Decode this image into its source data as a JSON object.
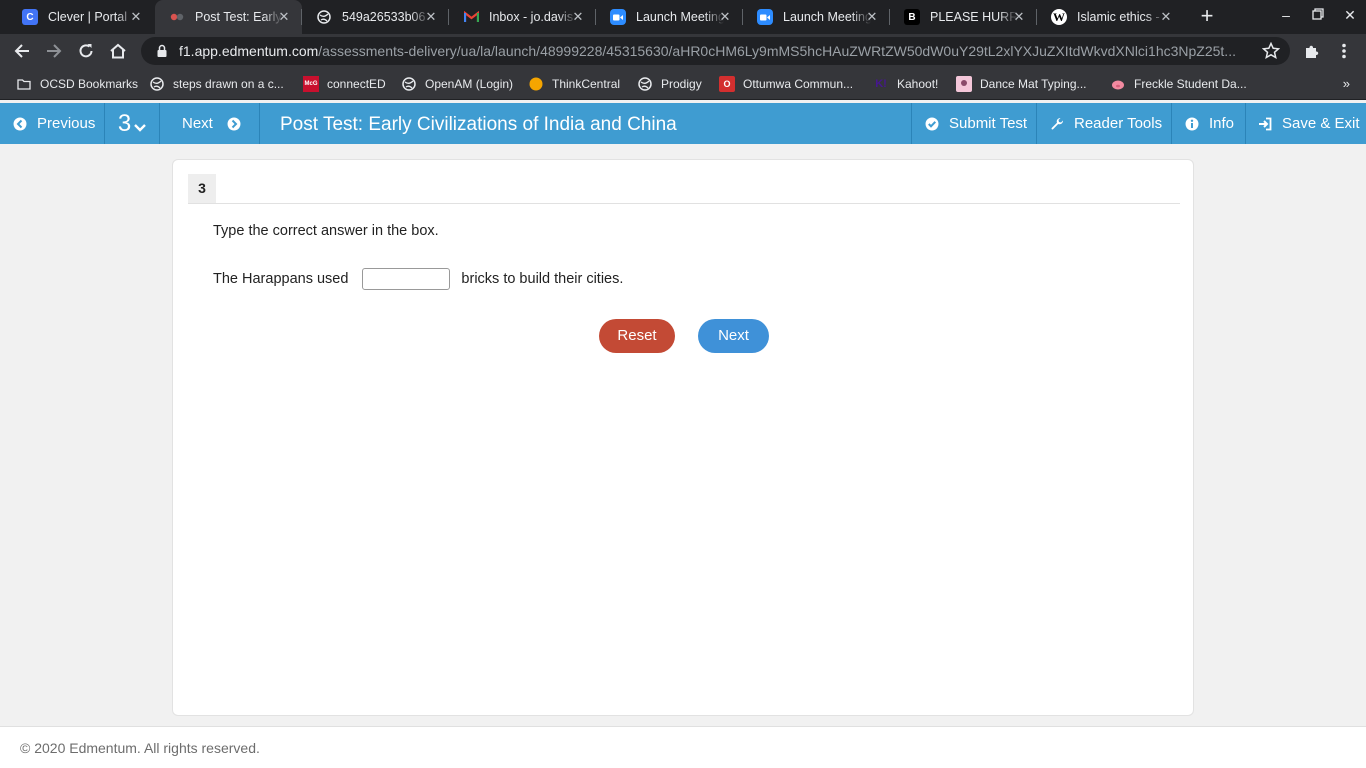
{
  "browser": {
    "tabs": [
      {
        "label": "Clever | Portal",
        "icon": "C",
        "icon_bg": "#4274f6"
      },
      {
        "label": "Post Test: Early",
        "icon": "edm",
        "icon_bg": "#35363a",
        "active": true
      },
      {
        "label": "549a26533b06",
        "icon": "globe",
        "icon_bg": "#35363a"
      },
      {
        "label": "Inbox - jo.davis",
        "icon": "M",
        "icon_bg": "#35363a"
      },
      {
        "label": "Launch Meeting",
        "icon": "zoom",
        "icon_bg": "#2d8cff"
      },
      {
        "label": "Launch Meeting",
        "icon": "zoom",
        "icon_bg": "#2d8cff"
      },
      {
        "label": "PLEASE HURRY",
        "icon": "B",
        "icon_bg": "#000000"
      },
      {
        "label": "Islamic ethics -",
        "icon": "W",
        "icon_bg": "#ffffff"
      }
    ],
    "url_host": "f1.app.edmentum.com",
    "url_path": "/assessments-delivery/ua/la/launch/48999228/45315630/aHR0cHM6Ly9mMS5hcHAuZWRtZW50dW0uY29tL2xlYXJuZXItdWkvdXNlci1hc3NpZ25t...",
    "bookmarks": [
      {
        "label": "OCSD Bookmarks",
        "icon": "folder"
      },
      {
        "label": "steps drawn on a c...",
        "icon": "globe"
      },
      {
        "label": "connectED",
        "icon": "mcgraw"
      },
      {
        "label": "OpenAM (Login)",
        "icon": "globe"
      },
      {
        "label": "ThinkCentral",
        "icon": "dot"
      },
      {
        "label": "Prodigy",
        "icon": "globe"
      },
      {
        "label": "Ottumwa Commun...",
        "icon": "O"
      },
      {
        "label": "Kahoot!",
        "icon": "K"
      },
      {
        "label": "Dance Mat Typing...",
        "icon": "dance"
      },
      {
        "label": "Freckle Student Da...",
        "icon": "pig"
      }
    ]
  },
  "edmentum": {
    "previous_label": "Previous",
    "question_number": "3",
    "next_label": "Next",
    "title": "Post Test: Early Civilizations of India and China",
    "submit_label": "Submit Test",
    "reader_tools_label": "Reader Tools",
    "info_label": "Info",
    "save_exit_label": "Save & Exit"
  },
  "question": {
    "number": "3",
    "instruction": "Type the correct answer in the box.",
    "sentence_before": "The Harappans used",
    "answer_value": "",
    "sentence_after": "bricks to build their cities.",
    "reset_label": "Reset",
    "next_label": "Next"
  },
  "footer": {
    "copyright": "© 2020 Edmentum. All rights reserved."
  },
  "colors": {
    "header_blue": "#3f9cd1",
    "reset_red": "#c34a35",
    "next_blue": "#3f91d8"
  }
}
